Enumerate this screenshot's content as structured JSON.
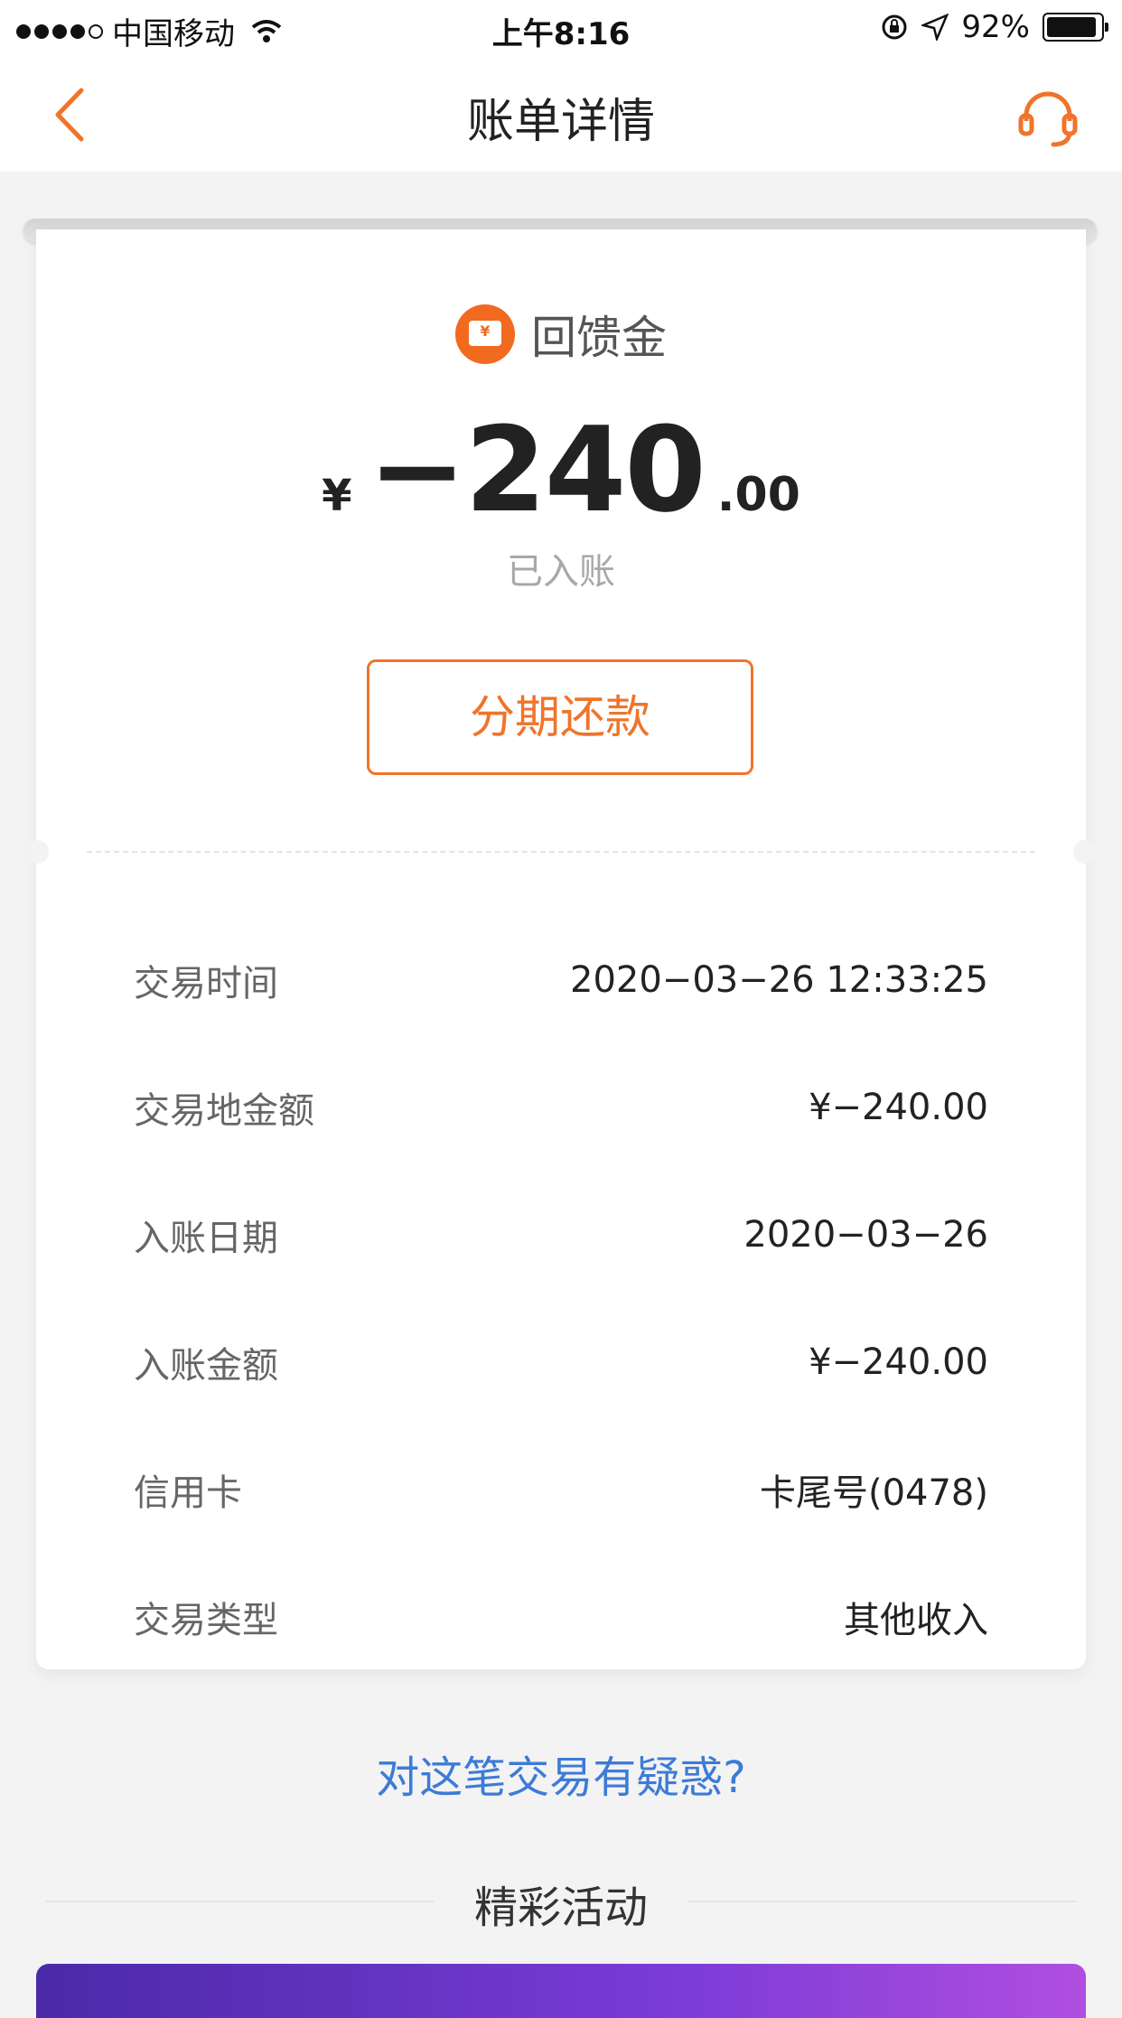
{
  "status_bar": {
    "carrier": "中国移动",
    "time": "上午8:16",
    "battery": "92%"
  },
  "nav": {
    "title": "账单详情",
    "back_icon": "chevron-left-icon",
    "service_icon": "headset-icon"
  },
  "detail": {
    "category_icon": "wallet-icon",
    "category": "回馈金",
    "amount_currency": "¥",
    "amount_integer": "−240",
    "amount_decimal": ".00",
    "status": "已入账",
    "installment_button": "分期还款"
  },
  "rows": [
    {
      "label": "交易时间",
      "value": "2020−03−26 12:33:25"
    },
    {
      "label": "交易地金额",
      "value": "¥−240.00"
    },
    {
      "label": "入账日期",
      "value": "2020−03−26"
    },
    {
      "label": "入账金额",
      "value": "¥−240.00"
    },
    {
      "label": "信用卡",
      "value": "卡尾号(0478)"
    },
    {
      "label": "交易类型",
      "value": "其他收入"
    }
  ],
  "doubt_link": "对这笔交易有疑惑?",
  "section_title": "精彩活动",
  "colors": {
    "accent": "#f0742a",
    "link": "#3d7bd6",
    "icon_orange": "#f16a1f"
  }
}
